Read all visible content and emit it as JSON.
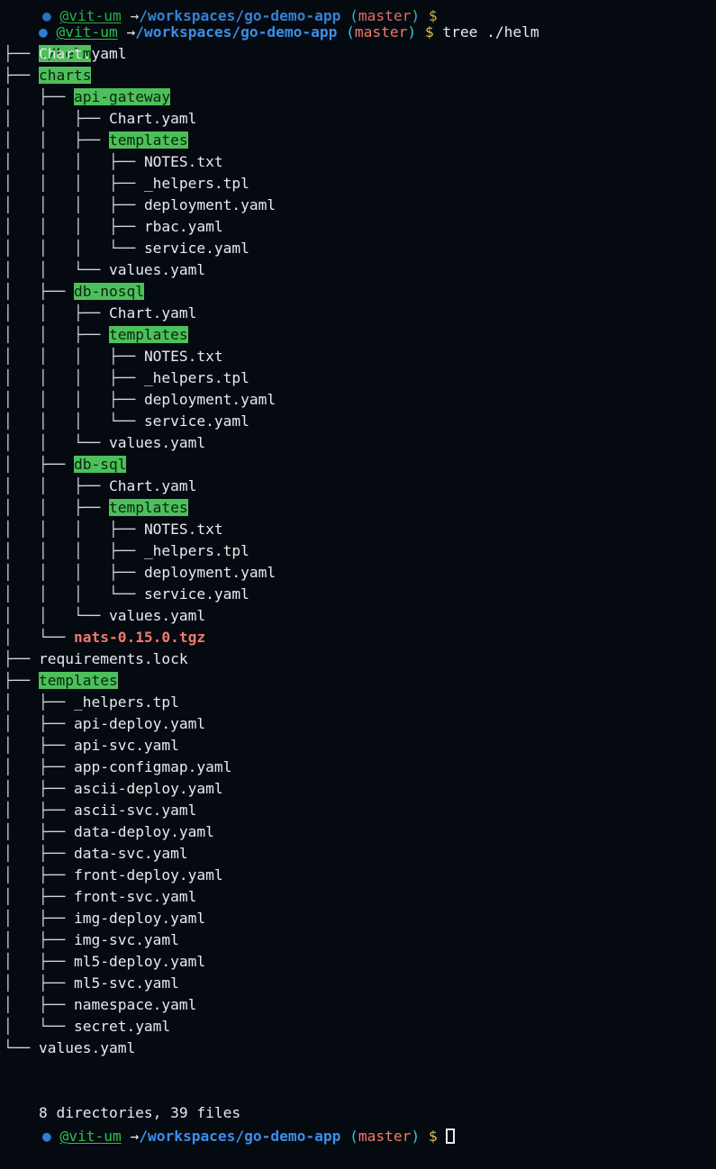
{
  "terminal": {
    "background": "#050a11",
    "foreground": "#e8eaed",
    "dir_highlight_bg": "#4cc05a",
    "dir_highlight_fg": "#0b2410",
    "archive_color": "#f07a6a",
    "path_color": "#3b8ee8",
    "user_color": "#2fbf4b",
    "branch_color": "#f07a6a",
    "paren_color": "#30c9d4",
    "dollar_color": "#d9c34a"
  },
  "prompt": {
    "bullet": "●",
    "user": "@vit-um",
    "arrow": "→",
    "path": "/workspaces/go-demo-app",
    "paren_open": "(",
    "branch": "master",
    "paren_close": ")",
    "dollar": "$",
    "command": "tree ./helm"
  },
  "root": {
    "label": "./helm"
  },
  "tree_lines": [
    {
      "prefix": "├── ",
      "name": "Chart.yaml",
      "kind": "file"
    },
    {
      "prefix": "├── ",
      "name": "charts",
      "kind": "dir"
    },
    {
      "prefix": "│   ├── ",
      "name": "api-gateway",
      "kind": "dir"
    },
    {
      "prefix": "│   │   ├── ",
      "name": "Chart.yaml",
      "kind": "file"
    },
    {
      "prefix": "│   │   ├── ",
      "name": "templates",
      "kind": "dir"
    },
    {
      "prefix": "│   │   │   ├── ",
      "name": "NOTES.txt",
      "kind": "file"
    },
    {
      "prefix": "│   │   │   ├── ",
      "name": "_helpers.tpl",
      "kind": "file"
    },
    {
      "prefix": "│   │   │   ├── ",
      "name": "deployment.yaml",
      "kind": "file"
    },
    {
      "prefix": "│   │   │   ├── ",
      "name": "rbac.yaml",
      "kind": "file"
    },
    {
      "prefix": "│   │   │   └── ",
      "name": "service.yaml",
      "kind": "file"
    },
    {
      "prefix": "│   │   └── ",
      "name": "values.yaml",
      "kind": "file"
    },
    {
      "prefix": "│   ├── ",
      "name": "db-nosql",
      "kind": "dir"
    },
    {
      "prefix": "│   │   ├── ",
      "name": "Chart.yaml",
      "kind": "file"
    },
    {
      "prefix": "│   │   ├── ",
      "name": "templates",
      "kind": "dir"
    },
    {
      "prefix": "│   │   │   ├── ",
      "name": "NOTES.txt",
      "kind": "file"
    },
    {
      "prefix": "│   │   │   ├── ",
      "name": "_helpers.tpl",
      "kind": "file"
    },
    {
      "prefix": "│   │   │   ├── ",
      "name": "deployment.yaml",
      "kind": "file"
    },
    {
      "prefix": "│   │   │   └── ",
      "name": "service.yaml",
      "kind": "file"
    },
    {
      "prefix": "│   │   └── ",
      "name": "values.yaml",
      "kind": "file"
    },
    {
      "prefix": "│   ├── ",
      "name": "db-sql",
      "kind": "dir"
    },
    {
      "prefix": "│   │   ├── ",
      "name": "Chart.yaml",
      "kind": "file"
    },
    {
      "prefix": "│   │   ├── ",
      "name": "templates",
      "kind": "dir"
    },
    {
      "prefix": "│   │   │   ├── ",
      "name": "NOTES.txt",
      "kind": "file"
    },
    {
      "prefix": "│   │   │   ├── ",
      "name": "_helpers.tpl",
      "kind": "file"
    },
    {
      "prefix": "│   │   │   ├── ",
      "name": "deployment.yaml",
      "kind": "file"
    },
    {
      "prefix": "│   │   │   └── ",
      "name": "service.yaml",
      "kind": "file"
    },
    {
      "prefix": "│   │   └── ",
      "name": "values.yaml",
      "kind": "file"
    },
    {
      "prefix": "│   └── ",
      "name": "nats-0.15.0.tgz",
      "kind": "archive"
    },
    {
      "prefix": "├── ",
      "name": "requirements.lock",
      "kind": "file"
    },
    {
      "prefix": "├── ",
      "name": "templates",
      "kind": "dir"
    },
    {
      "prefix": "│   ├── ",
      "name": "_helpers.tpl",
      "kind": "file"
    },
    {
      "prefix": "│   ├── ",
      "name": "api-deploy.yaml",
      "kind": "file"
    },
    {
      "prefix": "│   ├── ",
      "name": "api-svc.yaml",
      "kind": "file"
    },
    {
      "prefix": "│   ├── ",
      "name": "app-configmap.yaml",
      "kind": "file"
    },
    {
      "prefix": "│   ├── ",
      "name": "ascii-deploy.yaml",
      "kind": "file"
    },
    {
      "prefix": "│   ├── ",
      "name": "ascii-svc.yaml",
      "kind": "file"
    },
    {
      "prefix": "│   ├── ",
      "name": "data-deploy.yaml",
      "kind": "file"
    },
    {
      "prefix": "│   ├── ",
      "name": "data-svc.yaml",
      "kind": "file"
    },
    {
      "prefix": "│   ├── ",
      "name": "front-deploy.yaml",
      "kind": "file"
    },
    {
      "prefix": "│   ├── ",
      "name": "front-svc.yaml",
      "kind": "file"
    },
    {
      "prefix": "│   ├── ",
      "name": "img-deploy.yaml",
      "kind": "file"
    },
    {
      "prefix": "│   ├── ",
      "name": "img-svc.yaml",
      "kind": "file"
    },
    {
      "prefix": "│   ├── ",
      "name": "ml5-deploy.yaml",
      "kind": "file"
    },
    {
      "prefix": "│   ├── ",
      "name": "ml5-svc.yaml",
      "kind": "file"
    },
    {
      "prefix": "│   ├── ",
      "name": "namespace.yaml",
      "kind": "file"
    },
    {
      "prefix": "│   └── ",
      "name": "secret.yaml",
      "kind": "file"
    },
    {
      "prefix": "└── ",
      "name": "values.yaml",
      "kind": "file"
    }
  ],
  "summary": "8 directories, 39 files",
  "summary_counts": {
    "directories": 8,
    "files": 39
  }
}
